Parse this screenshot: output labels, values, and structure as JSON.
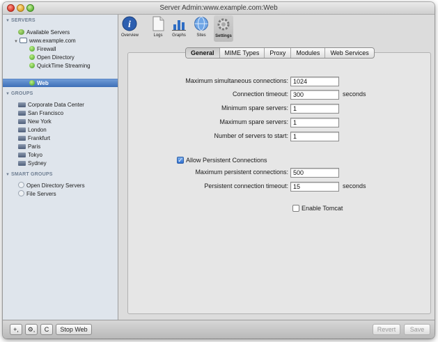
{
  "window": {
    "title": "Server Admin:www.example.com:Web"
  },
  "sidebar": {
    "servers_header": "SERVERS",
    "available_servers": "Available Servers",
    "server_name": "www.example.com",
    "services": [
      "Firewall",
      "Open Directory",
      "QuickTime Streaming",
      "Web"
    ],
    "groups_header": "GROUPS",
    "groups": [
      "Corporate Data Center",
      "San Francisco",
      "New York",
      "London",
      "Frankfurt",
      "Paris",
      "Tokyo",
      "Sydney"
    ],
    "smart_groups_header": "SMART GROUPS",
    "smart_groups": [
      "Open Directory Servers",
      "File Servers"
    ]
  },
  "toolbar": {
    "items": [
      "Overview",
      "Logs",
      "Graphs",
      "Sites",
      "Settings"
    ],
    "selected": "Settings"
  },
  "tabs": {
    "items": [
      "General",
      "MIME Types",
      "Proxy",
      "Modules",
      "Web Services"
    ],
    "active": "General"
  },
  "settings": {
    "max_connections_label": "Maximum simultaneous connections:",
    "max_connections_value": "1024",
    "timeout_label": "Connection timeout:",
    "timeout_value": "300",
    "timeout_unit": "seconds",
    "min_spare_label": "Minimum spare servers:",
    "min_spare_value": "1",
    "max_spare_label": "Maximum spare servers:",
    "max_spare_value": "1",
    "servers_to_start_label": "Number of servers to start:",
    "servers_to_start_value": "1",
    "persistent_checkbox_label": "Allow Persistent Connections",
    "persistent_checked": true,
    "max_persistent_label": "Maximum persistent connections:",
    "max_persistent_value": "500",
    "persistent_timeout_label": "Persistent connection timeout:",
    "persistent_timeout_value": "15",
    "persistent_timeout_unit": "seconds",
    "tomcat_label": "Enable Tomcat",
    "tomcat_checked": false
  },
  "bottom": {
    "add_label": "+,",
    "action_label": "⚙,",
    "refresh_label": "C",
    "stop_label": "Stop Web",
    "revert_label": "Revert",
    "save_label": "Save"
  }
}
